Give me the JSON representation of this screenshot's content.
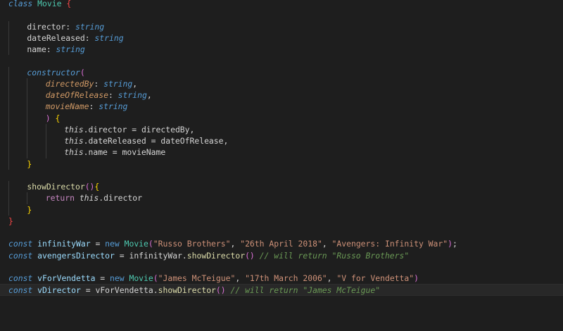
{
  "editor": {
    "language": "typescript",
    "lines": [
      {
        "indent": 0,
        "tokens": [
          {
            "t": "class",
            "c": "keyword",
            "i": true
          },
          {
            "t": " "
          },
          {
            "t": "Movie",
            "c": "class"
          },
          {
            "t": " "
          },
          {
            "t": "{",
            "c": "red"
          }
        ]
      },
      {
        "indent": 0,
        "tokens": []
      },
      {
        "indent": 1,
        "tokens": [
          {
            "t": "director",
            "c": "text"
          },
          {
            "t": ": ",
            "c": "text"
          },
          {
            "t": "string",
            "c": "type",
            "i": true
          }
        ]
      },
      {
        "indent": 1,
        "tokens": [
          {
            "t": "dateReleased",
            "c": "text"
          },
          {
            "t": ": ",
            "c": "text"
          },
          {
            "t": "string",
            "c": "type",
            "i": true
          }
        ]
      },
      {
        "indent": 1,
        "tokens": [
          {
            "t": "name",
            "c": "text"
          },
          {
            "t": ": ",
            "c": "text"
          },
          {
            "t": "string",
            "c": "type",
            "i": true
          }
        ]
      },
      {
        "indent": 0,
        "tokens": []
      },
      {
        "indent": 1,
        "tokens": [
          {
            "t": "constructor",
            "c": "keyword",
            "i": true
          },
          {
            "t": "(",
            "c": "brace2"
          }
        ]
      },
      {
        "indent": 2,
        "tokens": [
          {
            "t": "directedBy",
            "c": "param",
            "i": true
          },
          {
            "t": ": ",
            "c": "text"
          },
          {
            "t": "string",
            "c": "type",
            "i": true
          },
          {
            "t": ",",
            "c": "text"
          }
        ]
      },
      {
        "indent": 2,
        "tokens": [
          {
            "t": "dateOfRelease",
            "c": "param",
            "i": true
          },
          {
            "t": ": ",
            "c": "text"
          },
          {
            "t": "string",
            "c": "type",
            "i": true
          },
          {
            "t": ",",
            "c": "text"
          }
        ]
      },
      {
        "indent": 2,
        "tokens": [
          {
            "t": "movieName",
            "c": "param",
            "i": true
          },
          {
            "t": ": ",
            "c": "text"
          },
          {
            "t": "string",
            "c": "type",
            "i": true
          }
        ]
      },
      {
        "indent": 2,
        "tokens": [
          {
            "t": ")",
            "c": "brace2"
          },
          {
            "t": " "
          },
          {
            "t": "{",
            "c": "brace1"
          }
        ]
      },
      {
        "indent": 3,
        "tokens": [
          {
            "t": "this",
            "c": "this",
            "i": true
          },
          {
            "t": ".director",
            "c": "text"
          },
          {
            "t": " = ",
            "c": "text"
          },
          {
            "t": "directedBy",
            "c": "text"
          },
          {
            "t": ",",
            "c": "text"
          }
        ]
      },
      {
        "indent": 3,
        "tokens": [
          {
            "t": "this",
            "c": "this",
            "i": true
          },
          {
            "t": ".dateReleased",
            "c": "text"
          },
          {
            "t": " = ",
            "c": "text"
          },
          {
            "t": "dateOfRelease",
            "c": "text"
          },
          {
            "t": ",",
            "c": "text"
          }
        ]
      },
      {
        "indent": 3,
        "tokens": [
          {
            "t": "this",
            "c": "this",
            "i": true
          },
          {
            "t": ".name",
            "c": "text"
          },
          {
            "t": " = ",
            "c": "text"
          },
          {
            "t": "movieName",
            "c": "text"
          }
        ]
      },
      {
        "indent": 1,
        "tokens": [
          {
            "t": "}",
            "c": "brace1"
          }
        ]
      },
      {
        "indent": 0,
        "tokens": []
      },
      {
        "indent": 1,
        "tokens": [
          {
            "t": "showDirector",
            "c": "func"
          },
          {
            "t": "()",
            "c": "brace2"
          },
          {
            "t": "{",
            "c": "brace1"
          }
        ]
      },
      {
        "indent": 2,
        "tokens": [
          {
            "t": "return",
            "c": "control"
          },
          {
            "t": " "
          },
          {
            "t": "this",
            "c": "this",
            "i": true
          },
          {
            "t": ".director",
            "c": "text"
          }
        ]
      },
      {
        "indent": 1,
        "tokens": [
          {
            "t": "}",
            "c": "brace1"
          }
        ]
      },
      {
        "indent": 0,
        "tokens": [
          {
            "t": "}",
            "c": "red"
          }
        ]
      },
      {
        "indent": 0,
        "tokens": []
      },
      {
        "indent": 0,
        "tokens": [
          {
            "t": "const",
            "c": "keyword",
            "i": true
          },
          {
            "t": " "
          },
          {
            "t": "infinityWar",
            "c": "var"
          },
          {
            "t": " = ",
            "c": "text"
          },
          {
            "t": "new",
            "c": "keyword"
          },
          {
            "t": " "
          },
          {
            "t": "Movie",
            "c": "class"
          },
          {
            "t": "(",
            "c": "brace2"
          },
          {
            "t": "\"Russo Brothers\"",
            "c": "string"
          },
          {
            "t": ", ",
            "c": "text"
          },
          {
            "t": "\"26th April 2018\"",
            "c": "string"
          },
          {
            "t": ", ",
            "c": "text"
          },
          {
            "t": "\"Avengers: Infinity War\"",
            "c": "string"
          },
          {
            "t": ")",
            "c": "brace2"
          },
          {
            "t": ";",
            "c": "text"
          }
        ]
      },
      {
        "indent": 0,
        "tokens": [
          {
            "t": "const",
            "c": "keyword",
            "i": true
          },
          {
            "t": " "
          },
          {
            "t": "avengersDirector",
            "c": "var"
          },
          {
            "t": " = ",
            "c": "text"
          },
          {
            "t": "infinityWar",
            "c": "text"
          },
          {
            "t": ".",
            "c": "text"
          },
          {
            "t": "showDirector",
            "c": "func"
          },
          {
            "t": "()",
            "c": "brace2"
          },
          {
            "t": " "
          },
          {
            "t": "// will return \"Russo Brothers\"",
            "c": "comment",
            "i": true
          }
        ]
      },
      {
        "indent": 0,
        "tokens": []
      },
      {
        "indent": 0,
        "tokens": [
          {
            "t": "const",
            "c": "keyword",
            "i": true
          },
          {
            "t": " "
          },
          {
            "t": "vForVendetta",
            "c": "var"
          },
          {
            "t": " = ",
            "c": "text"
          },
          {
            "t": "new",
            "c": "keyword"
          },
          {
            "t": " "
          },
          {
            "t": "Movie",
            "c": "class"
          },
          {
            "t": "(",
            "c": "brace2"
          },
          {
            "t": "\"James McTeigue\"",
            "c": "string"
          },
          {
            "t": ", ",
            "c": "text"
          },
          {
            "t": "\"17th March 2006\"",
            "c": "string"
          },
          {
            "t": ", ",
            "c": "text"
          },
          {
            "t": "\"V for Vendetta\"",
            "c": "string"
          },
          {
            "t": ")",
            "c": "brace2"
          }
        ]
      },
      {
        "indent": 0,
        "current": true,
        "tokens": [
          {
            "t": "const",
            "c": "keyword",
            "i": true
          },
          {
            "t": " "
          },
          {
            "t": "vDirector",
            "c": "var"
          },
          {
            "t": " = ",
            "c": "text"
          },
          {
            "t": "vForVendetta",
            "c": "text"
          },
          {
            "t": ".",
            "c": "text"
          },
          {
            "t": "showDirector",
            "c": "func"
          },
          {
            "t": "()",
            "c": "brace2"
          },
          {
            "t": " "
          },
          {
            "t": "// will return \"James McTeigue\"",
            "c": "comment",
            "i": true
          }
        ]
      }
    ]
  }
}
